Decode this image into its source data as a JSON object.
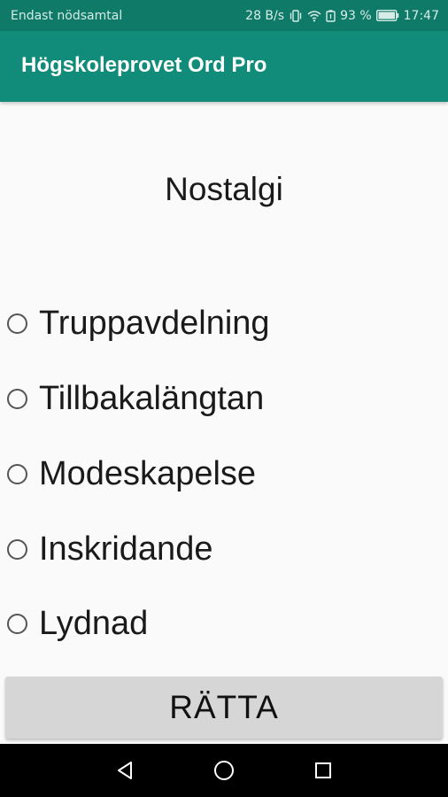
{
  "status_bar": {
    "carrier": "Endast nödsamtal",
    "network_speed": "28 B/s",
    "battery_percent": "93 %",
    "time": "17:47",
    "icons": [
      "vibrate-icon",
      "wifi-icon",
      "battery-saver-icon",
      "battery-icon"
    ]
  },
  "app_bar": {
    "title": "Högskoleprovet Ord Pro"
  },
  "quiz": {
    "word": "Nostalgi",
    "options": [
      {
        "label": "Truppavdelning",
        "selected": false
      },
      {
        "label": "Tillbakalängtan",
        "selected": false
      },
      {
        "label": "Modeskapelse",
        "selected": false
      },
      {
        "label": "Inskridande",
        "selected": false
      },
      {
        "label": "Lydnad",
        "selected": false
      }
    ],
    "check_button_label": "RÄTTA"
  },
  "nav_bar": {
    "icons": [
      "back-icon",
      "home-icon",
      "recents-icon"
    ]
  },
  "colors": {
    "status_bar": "#0f7a68",
    "app_bar": "#128c7a",
    "background": "#fafafa",
    "button": "#d6d6d6"
  }
}
